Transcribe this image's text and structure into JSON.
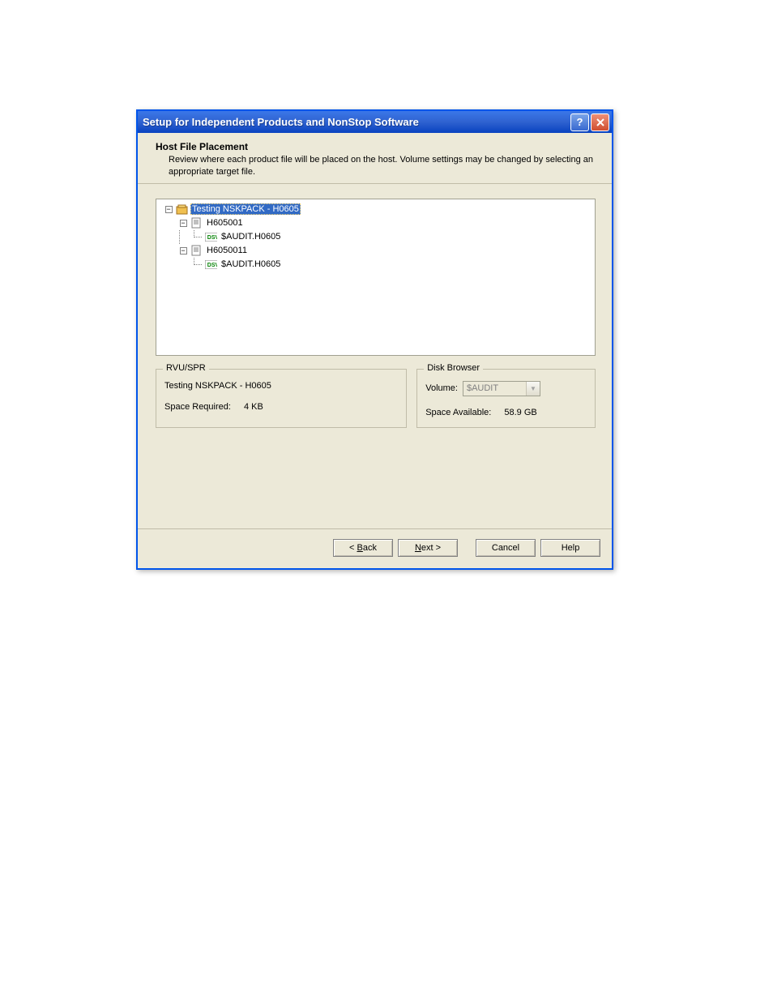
{
  "dialog": {
    "title": "Setup for Independent Products and NonStop Software",
    "header": {
      "title": "Host File Placement",
      "description": "Review where each product file will be placed on the host.  Volume settings may be changed by selecting an appropriate target file."
    },
    "tree": {
      "root": {
        "label": "Testing NSKPACK - H0605",
        "children": [
          {
            "label": "H605001",
            "children": [
              {
                "label": "$AUDIT.H0605",
                "type": "dsv"
              }
            ]
          },
          {
            "label": "H6050011",
            "children": [
              {
                "label": "$AUDIT.H0605",
                "type": "dsv"
              }
            ]
          }
        ]
      }
    },
    "rvuspr": {
      "legend": "RVU/SPR",
      "name": "Testing NSKPACK - H0605",
      "space_required_label": "Space Required:",
      "space_required_value": "4 KB"
    },
    "diskbrowser": {
      "legend": "Disk Browser",
      "volume_label": "Volume:",
      "volume_value": "$AUDIT",
      "space_available_label": "Space Available:",
      "space_available_value": "58.9 GB"
    },
    "buttons": {
      "back": "< Back",
      "next": "Next >",
      "cancel": "Cancel",
      "help": "Help"
    }
  }
}
